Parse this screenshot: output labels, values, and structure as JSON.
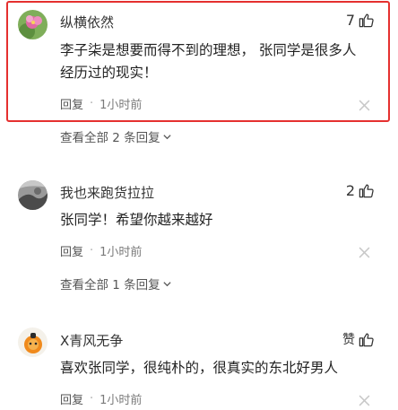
{
  "colors": {
    "highlight_border": "#e5302f"
  },
  "comments": [
    {
      "username": "纵横依然",
      "likes": "7",
      "content_line1": "李子柒是想要而得不到的理想， 张同学是很多人",
      "content_line2": "经历过的现实！",
      "reply_label": "回复",
      "separator": "·",
      "time": "1小时前",
      "view_all": "查看全部 2 条回复"
    },
    {
      "username": "我也来跑货拉拉",
      "likes": "2",
      "content_line1": "张同学！希望你越来越好",
      "reply_label": "回复",
      "separator": "·",
      "time": "1小时前",
      "view_all": "查看全部 1 条回复"
    },
    {
      "username": "X青风无争",
      "likes": "赞",
      "content_line1": "喜欢张同学，很纯朴的，很真实的东北好男人",
      "reply_label": "回复",
      "separator": "·",
      "time": "1小时前"
    }
  ]
}
